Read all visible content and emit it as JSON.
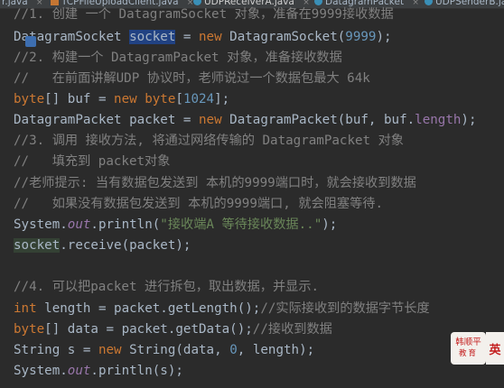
{
  "tabs": [
    {
      "label": "r.java",
      "icon": "java-file-icon",
      "active": false
    },
    {
      "label": "TCPFileUploadClient.java",
      "icon": "java-file-icon",
      "active": false
    },
    {
      "label": "UDPReceiverA.java",
      "icon": "java-class-icon",
      "active": true
    },
    {
      "label": "DatagramPacket",
      "icon": "class-icon",
      "active": false
    },
    {
      "label": "UDPSenderB.java",
      "icon": "java-class-icon",
      "active": false
    }
  ],
  "code": {
    "l0": "//1. 创建 一个 DatagramSocket 对象，准备在9999接收数据",
    "l1_a": "DatagramSocket ",
    "l1_b": "socket",
    "l1_c": " = ",
    "l1_d": "new",
    "l1_e": " DatagramSocket(",
    "l1_f": "9999",
    "l1_g": ");",
    "l2": "//2. 构建一个 DatagramPacket 对象，准备接收数据",
    "l3": "//   在前面讲解UDP 协议时，老师说过一个数据包最大 64k",
    "l4_a": "byte",
    "l4_b": "[] buf = ",
    "l4_c": "new",
    "l4_d": " ",
    "l4_e": "byte",
    "l4_f": "[",
    "l4_g": "1024",
    "l4_h": "];",
    "l5_a": "DatagramPacket packet = ",
    "l5_b": "new",
    "l5_c": " DatagramPacket(buf, buf.",
    "l5_d": "length",
    "l5_e": ");",
    "l6": "//3. 调用 接收方法, 将通过网络传输的 DatagramPacket 对象",
    "l7": "//   填充到 packet对象",
    "l8": "//老师提示: 当有数据包发送到 本机的9999端口时，就会接收到数据",
    "l9": "//   如果没有数据包发送到 本机的9999端口, 就会阻塞等待.",
    "l10_a": "System.",
    "l10_b": "out",
    "l10_c": ".println(",
    "l10_d": "\"接收端A 等待接收数据..\"",
    "l10_e": ");",
    "l11_a": "socket",
    "l11_b": ".receive(packet);",
    "l13": "//4. 可以把packet 进行拆包，取出数据，并显示.",
    "l14_a": "int",
    "l14_b": " length = packet.getLength();",
    "l14_c": "//实际接收到的数据字节长度",
    "l15_a": "byte",
    "l15_b": "[] data = packet.getData();",
    "l15_c": "//接收到数据",
    "l16_a": "String s = ",
    "l16_b": "new",
    "l16_c": " String(data, ",
    "l16_d": "0",
    "l16_e": ", length);",
    "l17_a": "System.",
    "l17_b": "out",
    "l17_c": ".println(s);"
  },
  "watermark": {
    "line1": "韩顺平",
    "line2": "教育",
    "side": "英"
  }
}
